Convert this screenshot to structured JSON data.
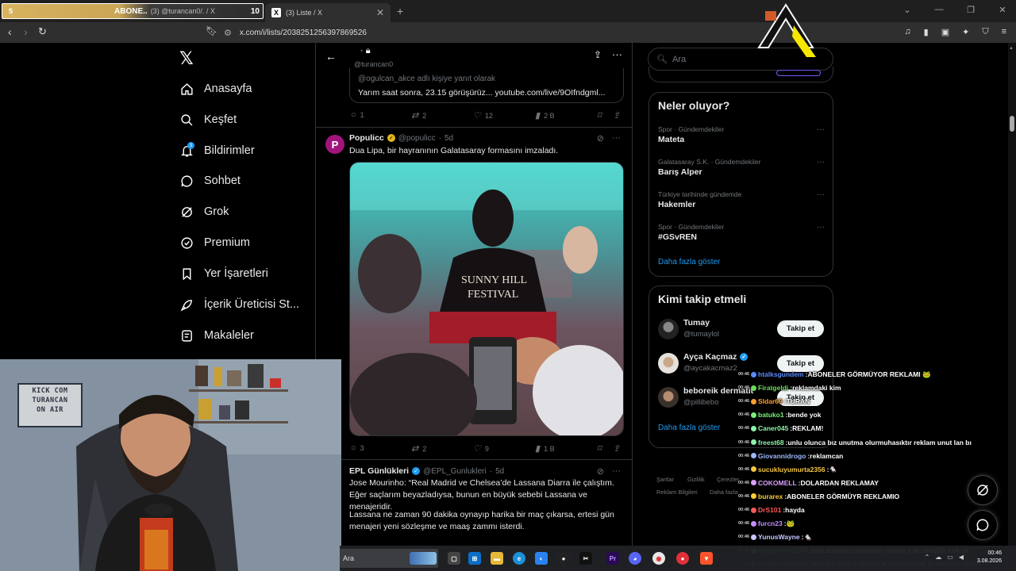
{
  "browser": {
    "tab1": {
      "number": "5",
      "title": "ABONE..",
      "subtitle": "(3) @turancan0/. / X",
      "count": "10"
    },
    "tab2": {
      "title": "(3) Liste / X"
    },
    "url": "x.com/i/lists/2038251256397869526"
  },
  "nav": {
    "items": [
      {
        "label": "Anasayfa",
        "icon": "home-icon"
      },
      {
        "label": "Keşfet",
        "icon": "search-icon"
      },
      {
        "label": "Bildirimler",
        "icon": "bell-icon",
        "badge": "3"
      },
      {
        "label": "Sohbet",
        "icon": "chat-icon"
      },
      {
        "label": "Grok",
        "icon": "grok-icon"
      },
      {
        "label": "Premium",
        "icon": "premium-icon"
      },
      {
        "label": "Yer İşaretleri",
        "icon": "bookmark-icon"
      },
      {
        "label": "İçerik Üreticisi St...",
        "icon": "rocket-icon"
      },
      {
        "label": "Makaleler",
        "icon": "article-icon"
      }
    ]
  },
  "list_header": {
    "handle": "@turancan0"
  },
  "tweets": [
    {
      "quote": {
        "reply_to": "@ogulcan_akce adlı kişiye yanıt olarak",
        "text": "Yarım saat sonra, 23.15 görüşürüz... youtube.com/live/9OIfndgml..."
      },
      "stats": {
        "replies": "1",
        "retweets": "2",
        "likes": "12",
        "views": "2 B"
      }
    },
    {
      "name": "Populicc",
      "handle": "@populicc",
      "time": "5d",
      "avatar_letter": "P",
      "text": "Dua Lipa, bir hayranının Galatasaray formasını imzaladı.",
      "stats": {
        "replies": "3",
        "retweets": "2",
        "likes": "9",
        "views": "1 B"
      }
    },
    {
      "name": "EPL Günlükleri",
      "handle": "@EPL_Gunlukleri",
      "time": "5d",
      "text1": "Jose Mourinho: “Real Madrid ve Chelsea’de Lassana Diarra ile çalıştım. Eğer saçlarım beyazladıysa, bunun en büyük sebebi Lassana ve menajeridir.",
      "text2": "Lassana ne zaman 90 dakika oynayıp harika bir maç çıkarsa, ertesi gün menajeri yeni sözleşme ve maaş zammı isterdi."
    }
  ],
  "search": {
    "placeholder": "Ara"
  },
  "trends": {
    "title": "Neler oluyor?",
    "items": [
      {
        "category": "Spor · Gündemdekiler",
        "name": "Mateta"
      },
      {
        "category": "Galatasaray S.K. · Gündemdekiler",
        "name": "Barış Alper"
      },
      {
        "category": "Türkiye tarihinde gündemde",
        "name": "Hakemler"
      },
      {
        "category": "Spor · Gündemdekiler",
        "name": "#GSvREN"
      }
    ],
    "show_more": "Daha fazla göster"
  },
  "who_to_follow": {
    "title": "Kimi takip etmeli",
    "users": [
      {
        "name": "Tumay",
        "handle": "@tumaylol",
        "button": "Takip et"
      },
      {
        "name": "Ayça Kaçmaz",
        "handle": "@aycakacmaz2",
        "button": "Takip et"
      },
      {
        "name": "beboreik dermatit",
        "handle": "@pillibebo",
        "button": "Takip et"
      }
    ],
    "show_more": "Daha fazla göster"
  },
  "footer": {
    "links": [
      "Şartlar",
      "Gizlilik",
      "Çerezler",
      "Reklam Bilgileri",
      "Daha fazla"
    ]
  },
  "webcam": {
    "sign_lines": [
      "KICK COM",
      "TURANCAN",
      "ON AIR"
    ]
  },
  "chat": {
    "lines": [
      {
        "time": "00:46",
        "user": "htalksgundem",
        "color": "#5b8bff",
        "msg": "ABONELER GÖRMÜYOR REKLAMI 🐸"
      },
      {
        "time": "00:46",
        "user": "Firatgeldi",
        "color": "#6bdc5a",
        "msg": "reklamdaki kim"
      },
      {
        "time": "00:46",
        "user": "Sldar69",
        "color": "#ff9d2e",
        "msg": "TURAN"
      },
      {
        "time": "00:46",
        "user": "batuko1",
        "color": "#7cf07c",
        "msg": "bende yok"
      },
      {
        "time": "00:46",
        "user": "Caner045",
        "color": "#8ef2a8",
        "msg": "REKLAM!"
      },
      {
        "time": "00:46",
        "user": "freest68",
        "color": "#8ef2a8",
        "msg": "unlu olunca bız unutma olurmuhasıktır reklam unut lan bı"
      },
      {
        "time": "00:46",
        "user": "Giovannidrogo",
        "color": "#9db7ff",
        "msg": "reklamcan"
      },
      {
        "time": "00:46",
        "user": "sucukluyumurta2356",
        "color": "#f5c542",
        "msg": "🐁"
      },
      {
        "time": "00:46",
        "user": "COKOMELL",
        "color": "#d9a0ff",
        "msg": "DOLARDAN REKLAMAY"
      },
      {
        "time": "00:46",
        "user": "burarex",
        "color": "#ffcc33",
        "msg": "ABONELER GÖRMÜYR REKLAMIO"
      },
      {
        "time": "00:46",
        "user": "DrS101",
        "color": "#ff5a5a",
        "msg": "hayda"
      },
      {
        "time": "00:46",
        "user": "furcn23",
        "color": "#c58bff",
        "msg": "🐸"
      },
      {
        "time": "00:46",
        "user": "YunusWayne",
        "color": "#c8c8ff",
        "msg": "🐁"
      },
      {
        "time": "00:46",
        "user": "ismayilovv2004",
        "color": "#7cf07c",
        "msg": "ben azerbaycandanim reklam yok simdilik cok iyi"
      },
      {
        "time": "00:46",
        "user": "bellamuhadla19",
        "color": "#9db7ff",
        "msg": "ABI GS KURA YAYINI HTALKSDAMI BURDAMI OLUR"
      }
    ]
  },
  "taskbar": {
    "search_placeholder": "Ara",
    "clock_time": "00:46",
    "clock_date": "3.08.2026"
  }
}
